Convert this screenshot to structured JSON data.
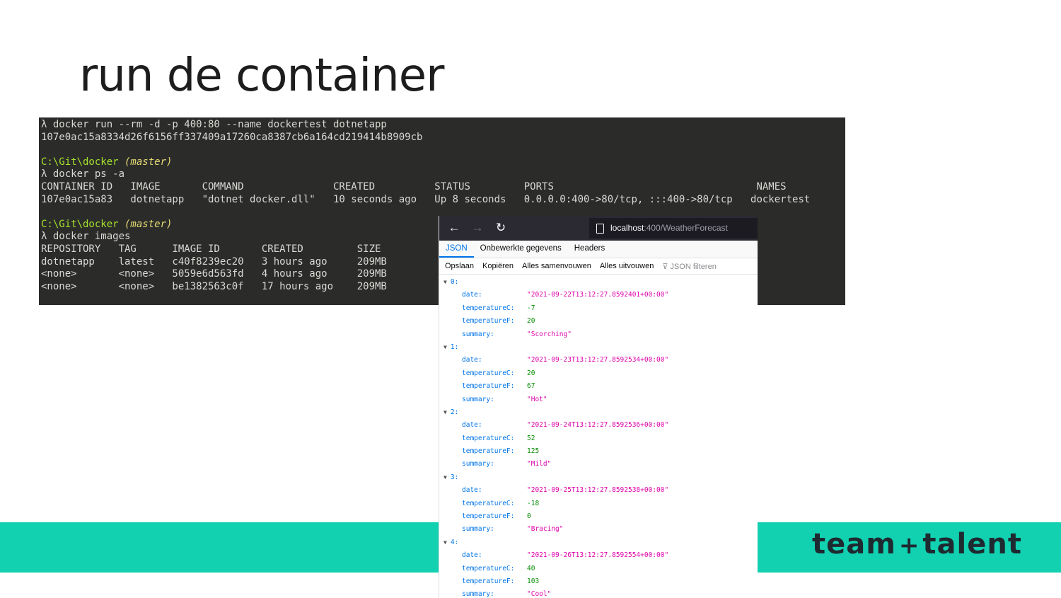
{
  "slide": {
    "title": "run de container",
    "logo": {
      "word1": "team",
      "plus": "+",
      "word2": "talent"
    },
    "colors": {
      "band": "#11d1b1",
      "logo_text": "#1e2a30"
    }
  },
  "terminal": {
    "lines": [
      "λ docker run --rm -d -p 400:80 --name dockertest dotnetapp",
      "107e0ac15a8334d26f6156ff337409a17260ca8387cb6a164cd219414b8909cb",
      "",
      "C:\\Git\\docker (master)",
      "λ docker ps -a",
      "CONTAINER ID   IMAGE       COMMAND               CREATED          STATUS         PORTS                                  NAMES",
      "107e0ac15a83   dotnetapp   \"dotnet docker.dll\"   10 seconds ago   Up 8 seconds   0.0.0.0:400->80/tcp, :::400->80/tcp   dockertest",
      "",
      "C:\\Git\\docker (master)",
      "λ docker images",
      "REPOSITORY   TAG      IMAGE ID       CREATED         SIZE",
      "dotnetapp    latest   c40f8239ec20   3 hours ago     209MB",
      "<none>       <none>   5059e6d563fd   4 hours ago     209MB",
      "<none>       <none>   be1382563c0f   17 hours ago    209MB"
    ],
    "prompt_path": "C:\\Git\\docker",
    "prompt_branch": "(master)"
  },
  "browser": {
    "url_host": "localhost",
    "url_rest": ":400/WeatherForecast",
    "tabs": [
      "JSON",
      "Onbewerkte gegevens",
      "Headers"
    ],
    "active_tab": "JSON",
    "tools": [
      "Opslaan",
      "Kopiëren",
      "Alles samenvouwen",
      "Alles uitvouwen"
    ],
    "filter_placeholder": "JSON filteren",
    "items": [
      {
        "index": "0:",
        "date": "\"2021-09-22T13:12:27.8592401+00:00\"",
        "temperatureC": "-7",
        "temperatureF": "20",
        "summary": "\"Scorching\""
      },
      {
        "index": "1:",
        "date": "\"2021-09-23T13:12:27.8592534+00:00\"",
        "temperatureC": "20",
        "temperatureF": "67",
        "summary": "\"Hot\""
      },
      {
        "index": "2:",
        "date": "\"2021-09-24T13:12:27.8592536+00:00\"",
        "temperatureC": "52",
        "temperatureF": "125",
        "summary": "\"Mild\""
      },
      {
        "index": "3:",
        "date": "\"2021-09-25T13:12:27.8592538+00:00\"",
        "temperatureC": "-18",
        "temperatureF": "0",
        "summary": "\"Bracing\""
      },
      {
        "index": "4:",
        "date": "\"2021-09-26T13:12:27.8592554+00:00\"",
        "temperatureC": "40",
        "temperatureF": "103",
        "summary": "\"Cool\""
      }
    ],
    "keys": {
      "date": "date:",
      "temperatureC": "temperatureC:",
      "temperatureF": "temperatureF:",
      "summary": "summary:"
    }
  }
}
